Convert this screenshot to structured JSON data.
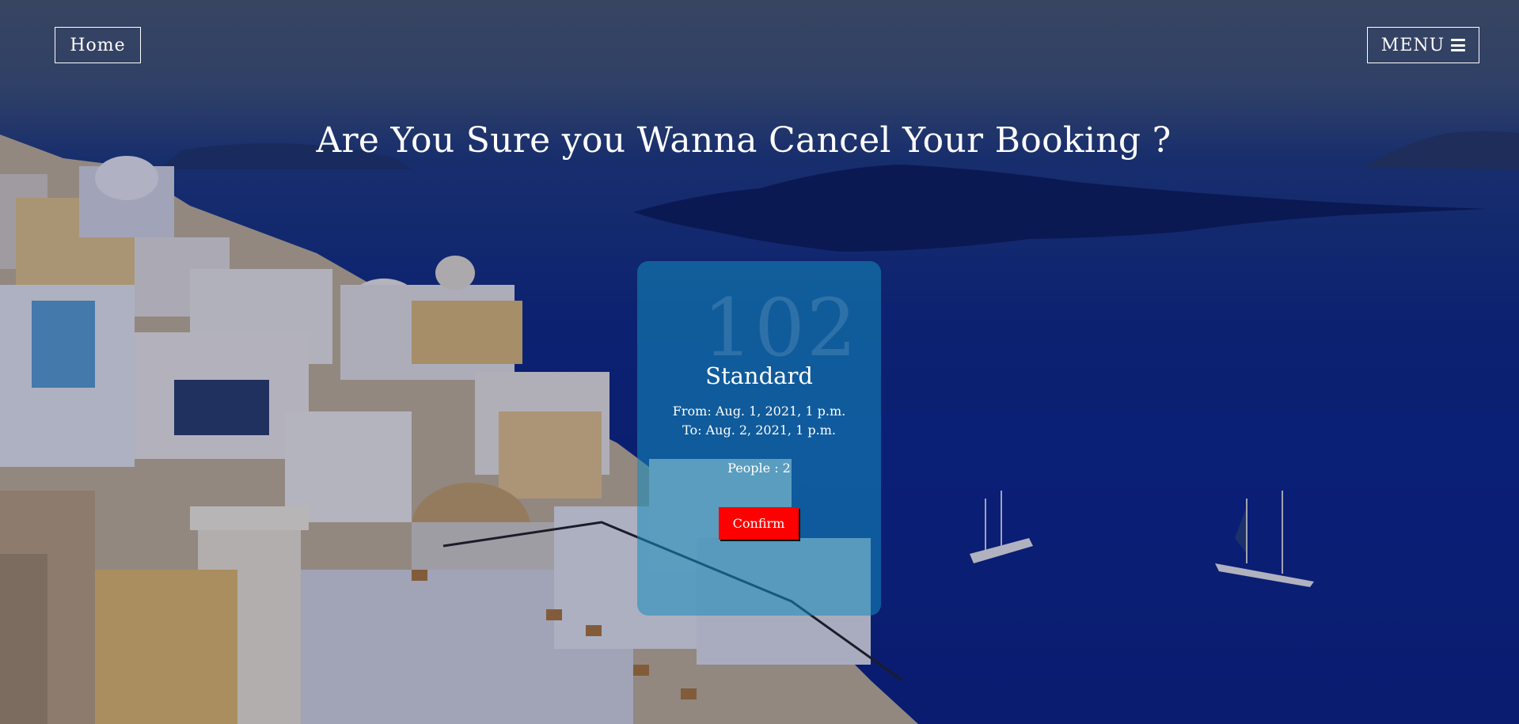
{
  "nav": {
    "home_label": "Home",
    "menu_label": "MENU",
    "menu_icon": "hamburger-icon"
  },
  "page": {
    "title": "Are You Sure you Wanna Cancel Your Booking ?"
  },
  "booking": {
    "room_number": "102",
    "room_type": "Standard",
    "from": "From: Aug. 1, 2021, 1 p.m.",
    "to": "To: Aug. 2, 2021, 1 p.m.",
    "people": "People : 2",
    "confirm_label": "Confirm"
  },
  "colors": {
    "confirm_button": "#ff0000",
    "card": "rgba(20,140,190,0.55)",
    "sea": "#0b2486"
  }
}
